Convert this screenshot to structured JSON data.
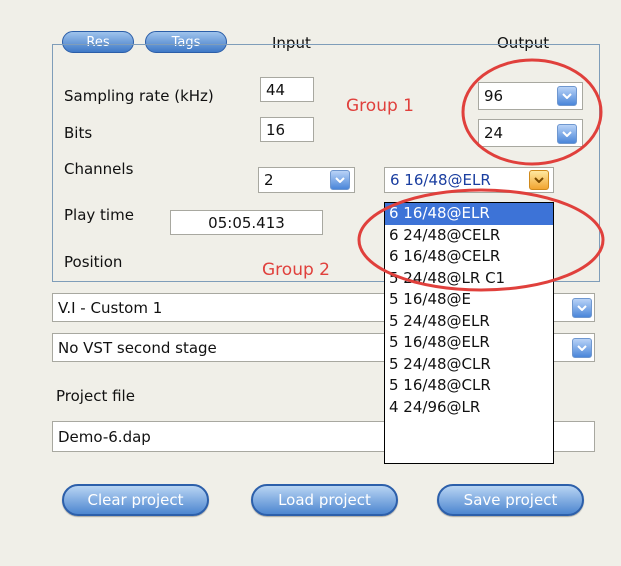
{
  "tabs": [
    "Res",
    "Tags"
  ],
  "headers": {
    "input": "Input",
    "output": "Output"
  },
  "rows": {
    "sampling_rate": {
      "label": "Sampling rate (kHz)",
      "input": "44",
      "output": "96"
    },
    "bits": {
      "label": "Bits",
      "input": "16",
      "output": "24"
    },
    "channels": {
      "label": "Channels",
      "input": "2",
      "output": "6 16/48@ELR"
    },
    "play_time": {
      "label": "Play time",
      "value": "05:05.413"
    },
    "position": {
      "label": "Position"
    }
  },
  "annotations": {
    "group1": "Group 1",
    "group2": "Group 2"
  },
  "selects": {
    "preset": "V.I - Custom 1",
    "vst": "No VST second stage"
  },
  "project": {
    "label": "Project file",
    "file": "Demo-6.dap"
  },
  "channel_options": [
    "6 16/48@ELR",
    "6 24/48@CELR",
    "6 16/48@CELR",
    "5 24/48@LR C1",
    "5 16/48@E",
    "5 24/48@ELR",
    "5 16/48@ELR",
    "5 24/48@CLR",
    "5 16/48@CLR",
    "4 24/96@LR"
  ],
  "buttons": {
    "clear": "Clear project",
    "load": "Load project",
    "save": "Save project"
  },
  "colors": {
    "accent": "#3d73d7",
    "annotation_red": "#e0403c",
    "button_blue": "#4d86d0"
  }
}
